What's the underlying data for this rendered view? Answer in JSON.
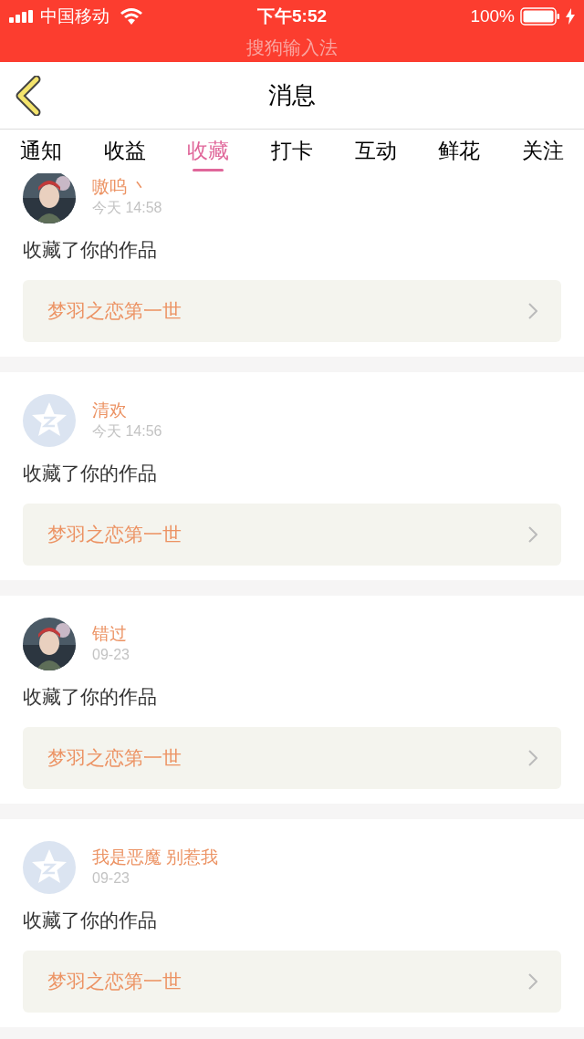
{
  "status_bar": {
    "carrier": "中国移动",
    "time": "下午5:52",
    "battery": "100%",
    "app_hint": "搜狗输入法"
  },
  "header": {
    "title": "消息"
  },
  "tabs": [
    {
      "label": "通知",
      "selected": false
    },
    {
      "label": "收益",
      "selected": false
    },
    {
      "label": "收藏",
      "selected": true
    },
    {
      "label": "打卡",
      "selected": false
    },
    {
      "label": "互动",
      "selected": false
    },
    {
      "label": "鲜花",
      "selected": false
    },
    {
      "label": "关注",
      "selected": false
    }
  ],
  "messages": [
    {
      "name": "嗷呜 丶",
      "time": "今天 14:58",
      "text": "收藏了你的作品",
      "work": "梦羽之恋第一世"
    },
    {
      "avatar": {
        "kind": "default"
      },
      "name": "清欢",
      "time": "今天 14:56",
      "text": "收藏了你的作品",
      "work": "梦羽之恋第一世"
    },
    {
      "name": "错过",
      "time": "09-23",
      "text": "收藏了你的作品",
      "work": "梦羽之恋第一世"
    },
    {
      "avatar": {
        "kind": "default"
      },
      "name": "我是恶魔 别惹我",
      "time": "09-23",
      "text": "收藏了你的作品",
      "work": "梦羽之恋第一世"
    }
  ]
}
